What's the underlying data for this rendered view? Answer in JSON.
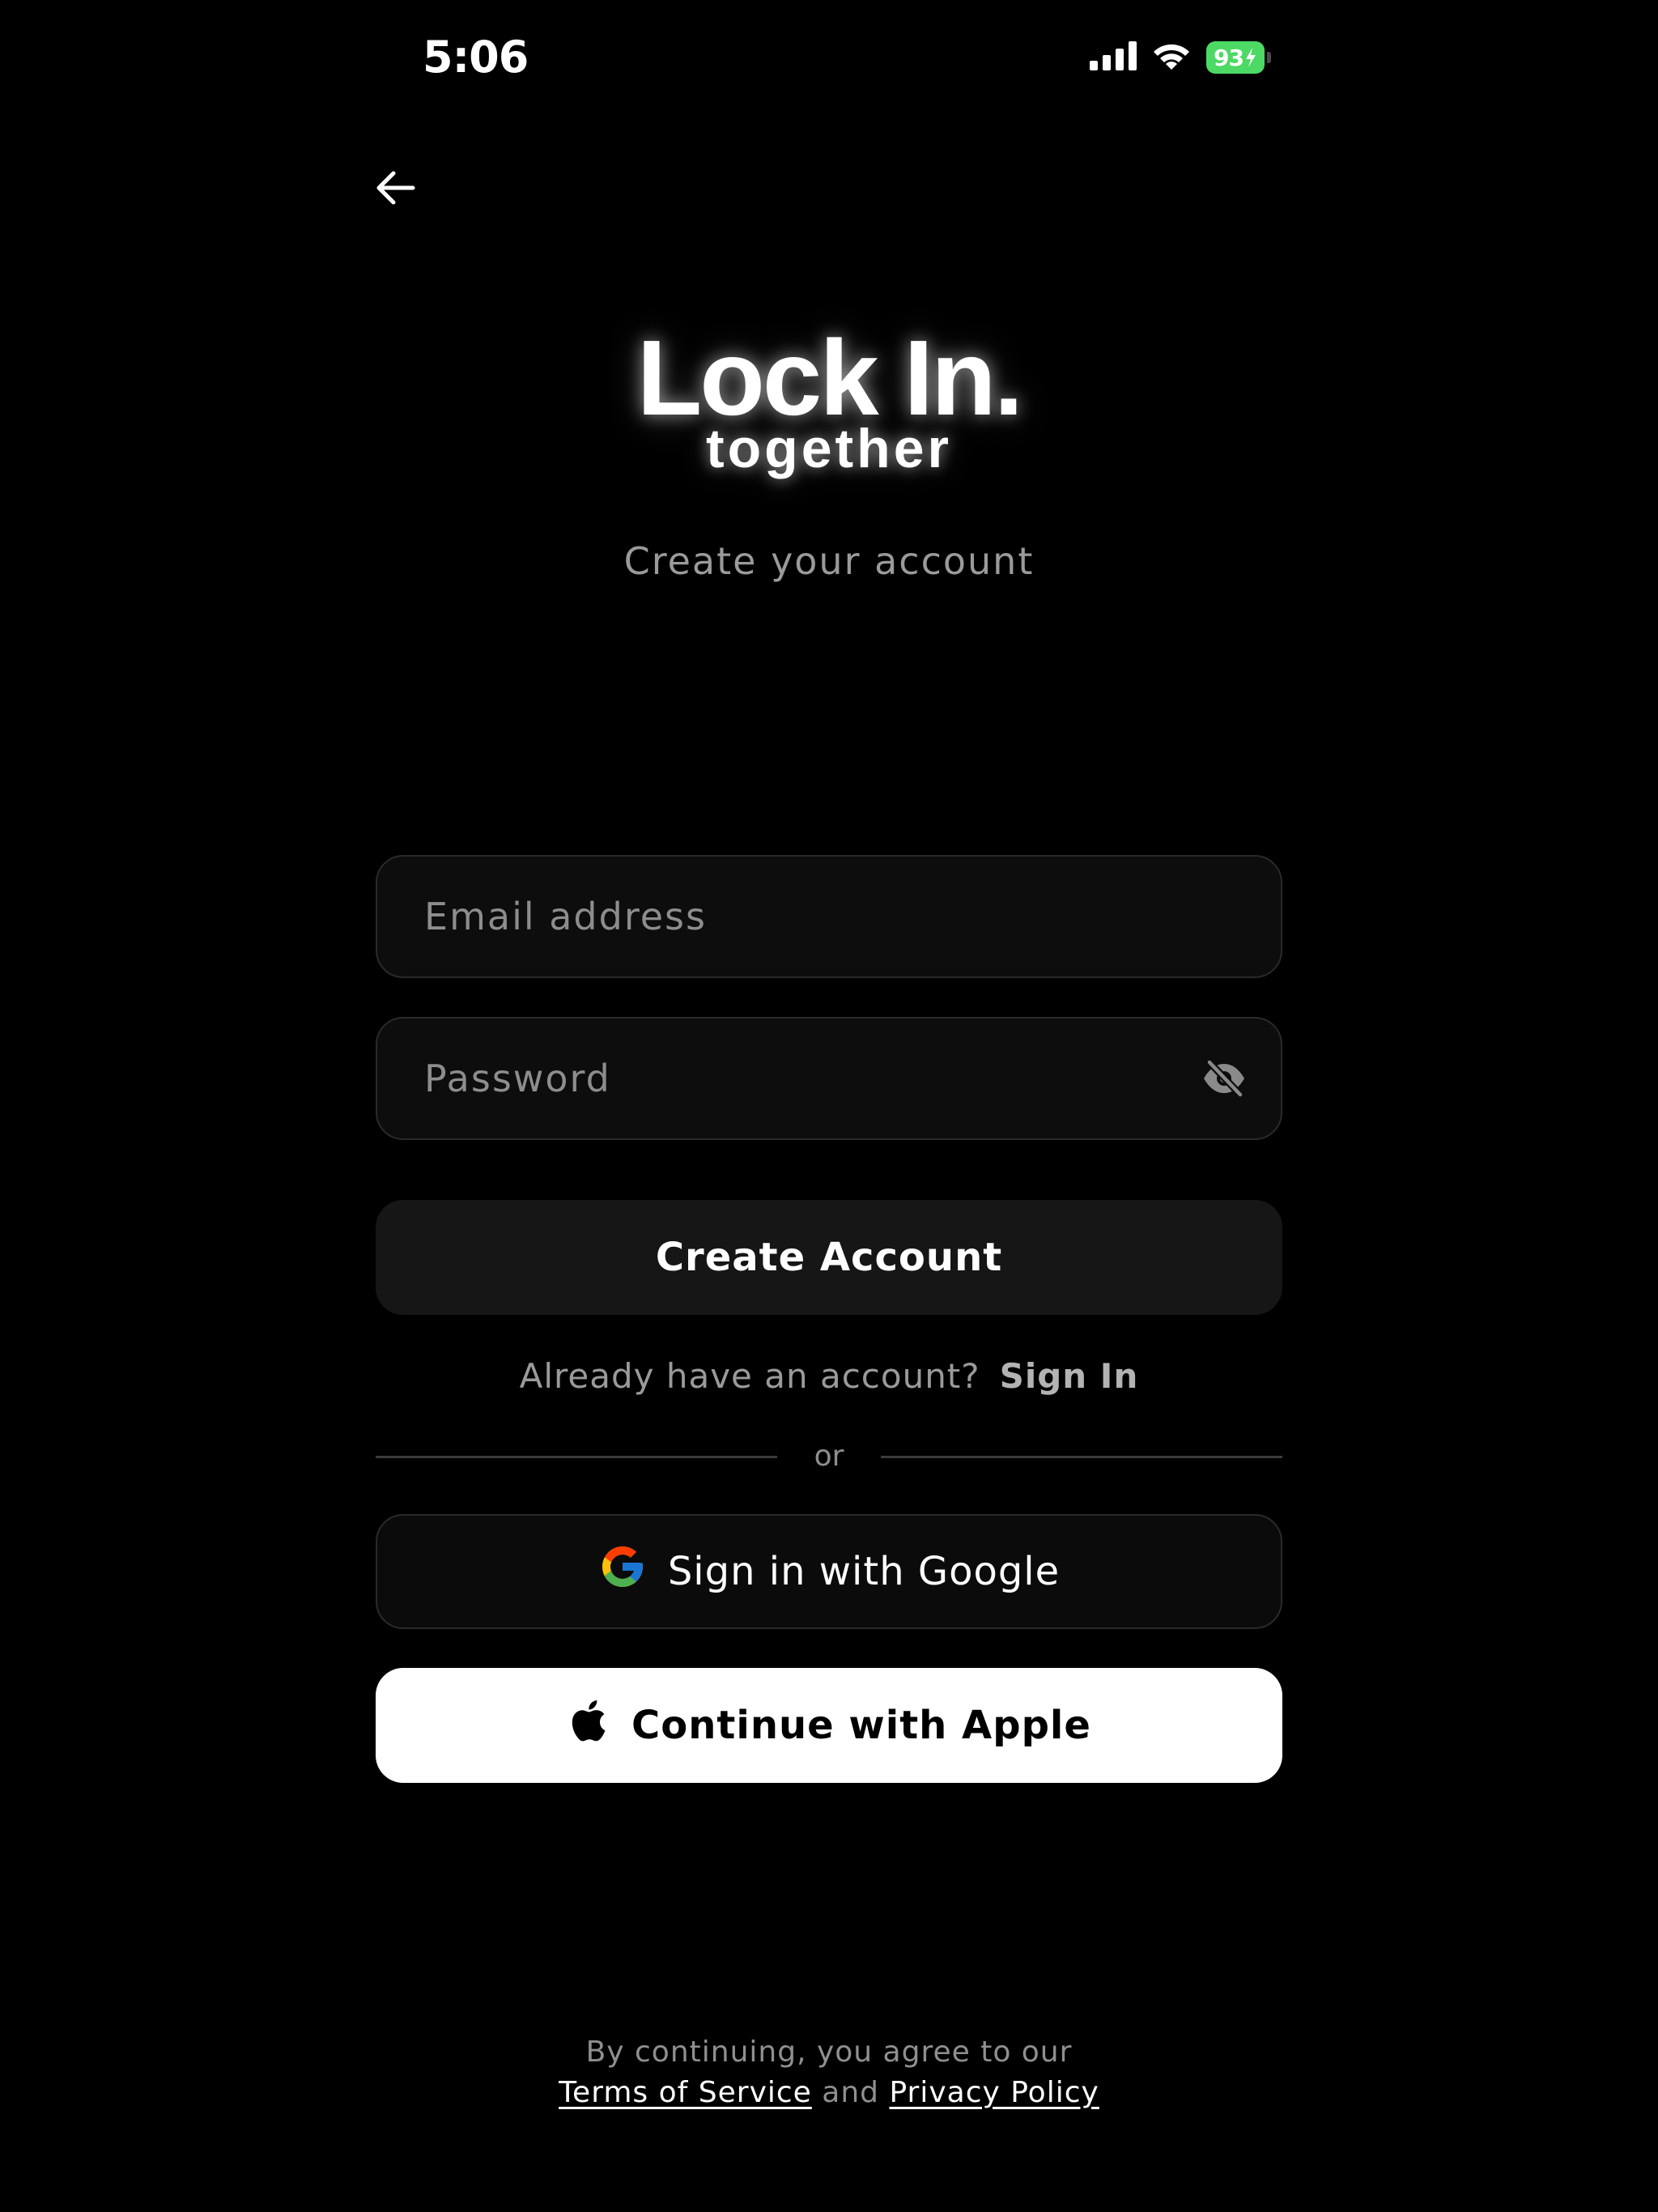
{
  "status_bar": {
    "time": "5:06",
    "battery": "93",
    "icons": [
      "cellular-signal-icon",
      "wifi-icon",
      "battery-charging-icon"
    ]
  },
  "header": {
    "back_icon": "arrow-left-icon"
  },
  "logo": {
    "title": "Lock In.",
    "subtitle": "together"
  },
  "tagline": "Create your account",
  "form": {
    "email_placeholder": "Email address",
    "password_placeholder": "Password",
    "visibility_icon": "eye-off-icon",
    "create_button": "Create Account"
  },
  "signin": {
    "prompt": "Already have an account?",
    "link": "Sign In"
  },
  "divider": "or",
  "social": {
    "google_label": "Sign in with Google",
    "apple_label": "Continue with Apple"
  },
  "legal": {
    "line1": "By continuing, you agree to our",
    "terms": "Terms of Service",
    "and": "and",
    "privacy": "Privacy Policy"
  },
  "colors": {
    "background": "#000000",
    "battery": "#4cd964",
    "muted_text": "#9a9a9a",
    "field_border": "#2a2a2a"
  }
}
